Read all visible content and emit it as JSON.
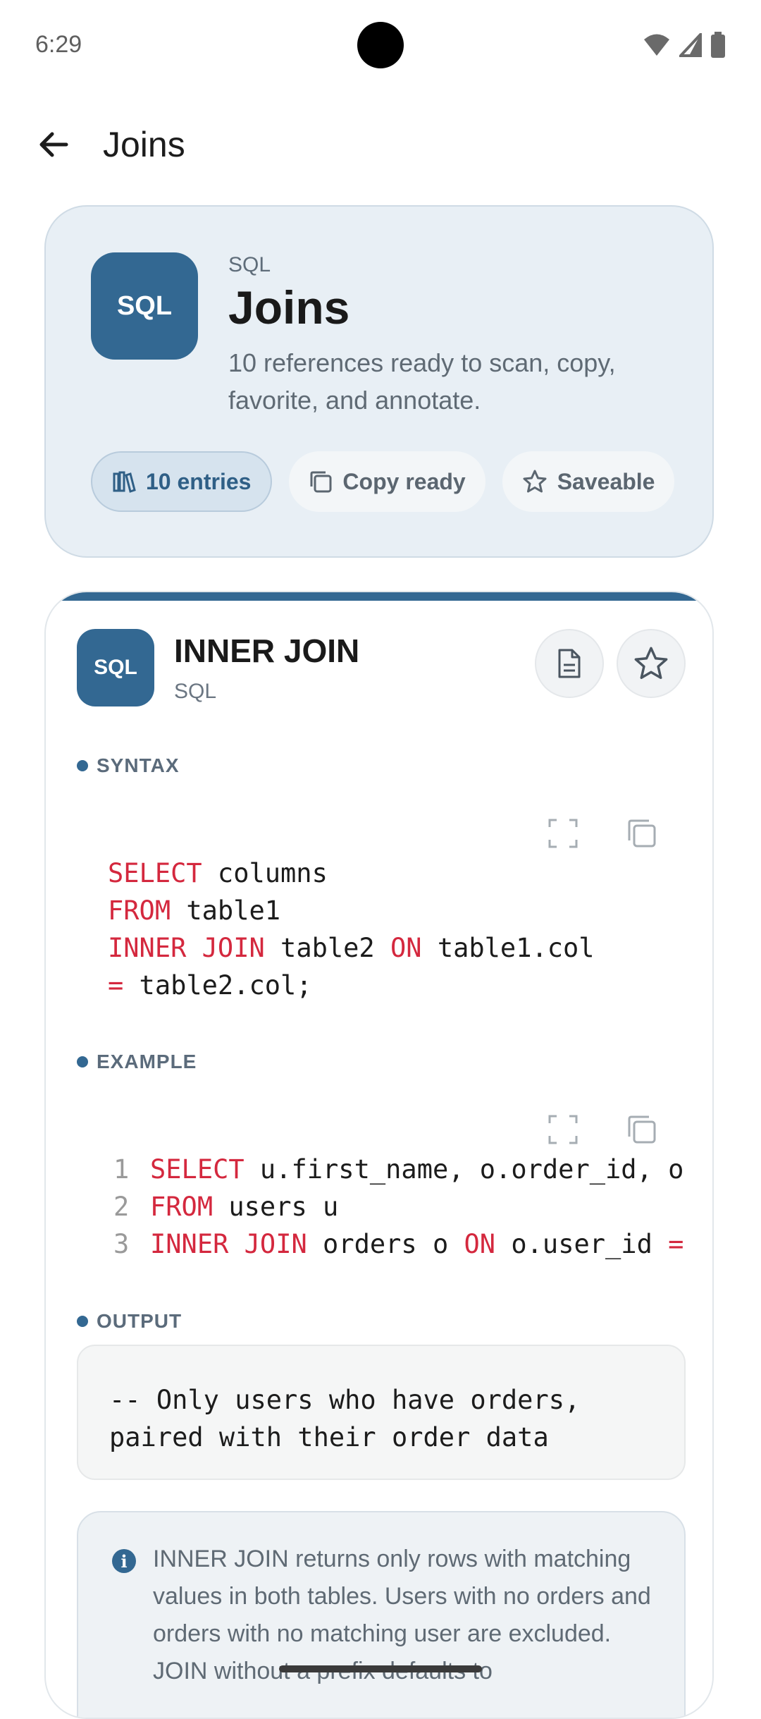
{
  "status_bar": {
    "time": "6:29"
  },
  "app_bar": {
    "title": "Joins"
  },
  "hero": {
    "badge": "SQL",
    "category": "SQL",
    "title": "Joins",
    "description": "10 references ready to scan, copy, favorite, and annotate.",
    "chips": [
      "10 entries",
      "Copy ready",
      "Saveable"
    ]
  },
  "entry": {
    "badge": "SQL",
    "title": "INNER JOIN",
    "subtitle": "SQL",
    "syntax_label": "SYNTAX",
    "syntax_lines": [
      [
        "SELECT",
        " columns"
      ],
      [
        "FROM",
        " table1"
      ],
      [
        "INNER JOIN",
        " table2 ",
        "ON",
        " table1.col"
      ],
      [
        "=",
        " table2.col;"
      ]
    ],
    "example_label": "EXAMPLE",
    "example_lines": [
      {
        "n": "1",
        "kw": "SELECT",
        "rest": " u.first_name, o.order_id, o."
      },
      {
        "n": "2",
        "kw": "FROM",
        "rest": " users u"
      },
      {
        "n": "3",
        "kw": "INNER JOIN",
        "rest": " orders o ",
        "kw2": "ON",
        "rest2": " o.user_id ",
        "kw3": "="
      }
    ],
    "output_label": "OUTPUT",
    "output_text": "-- Only users who have orders,\npaired with their order data",
    "note": "INNER JOIN returns only rows with matching values in both tables. Users with no orders and orders with no matching user are excluded. JOIN without a prefix defaults to"
  },
  "colors": {
    "accent": "#336892",
    "keyword": "#d4283e"
  }
}
